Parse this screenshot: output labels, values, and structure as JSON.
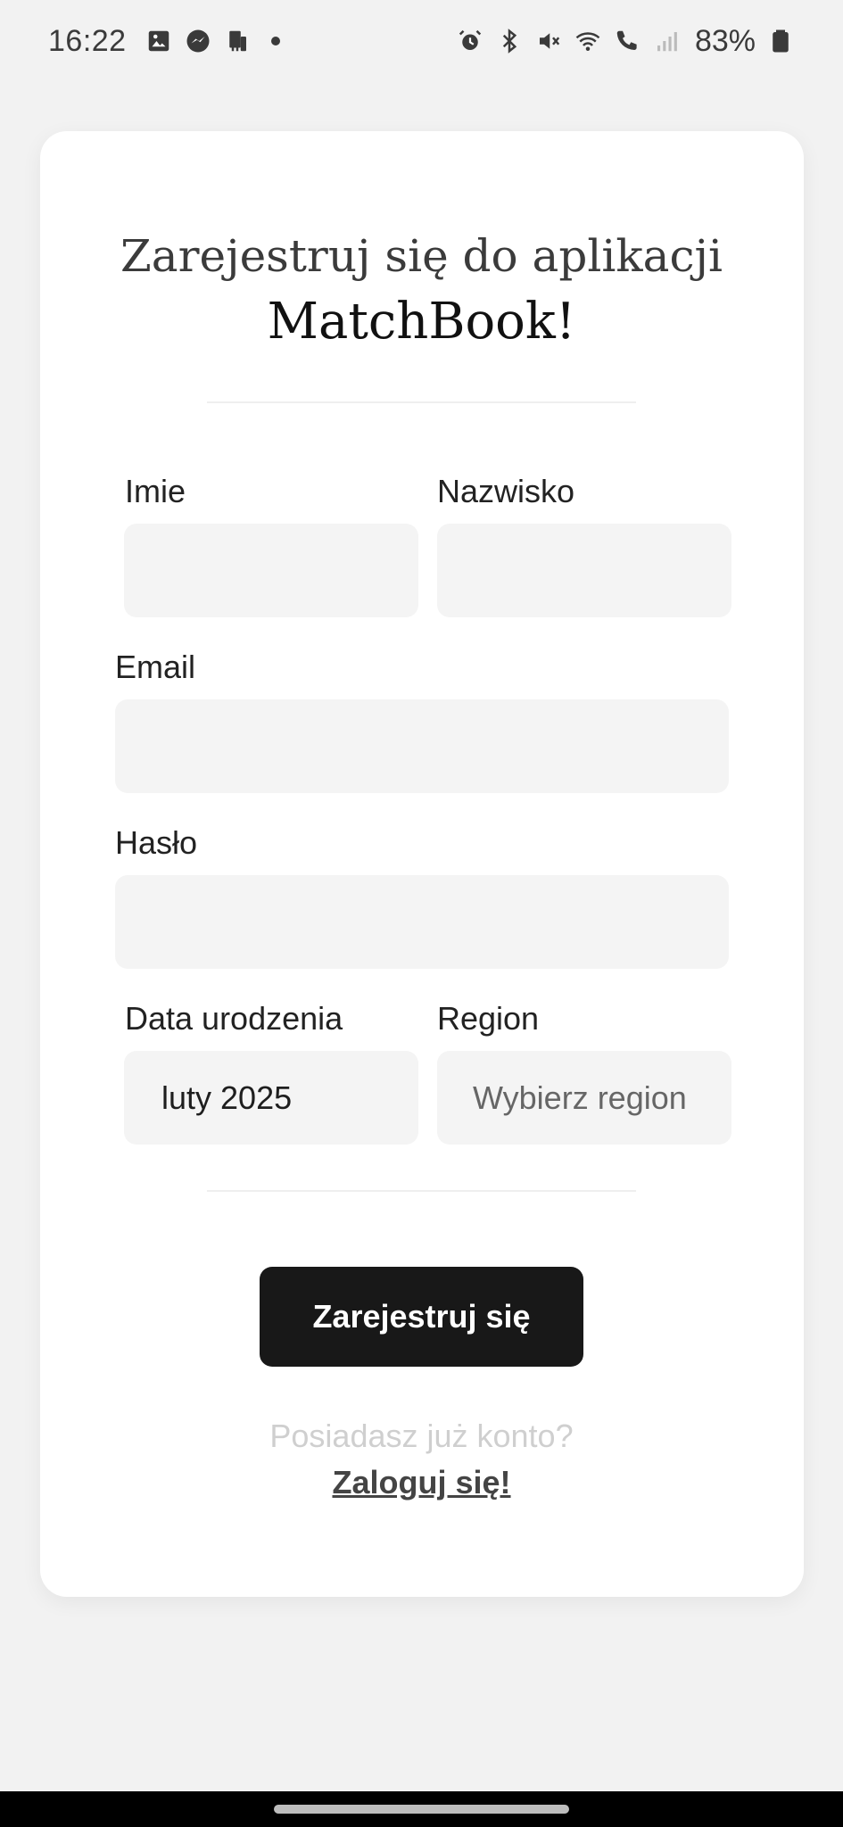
{
  "status_bar": {
    "time": "16:22",
    "left_icons": [
      "image-icon",
      "messenger-icon",
      "remote-icon",
      "dot"
    ],
    "right_icons": [
      "alarm-icon",
      "bluetooth-icon",
      "mute-icon",
      "wifi-icon",
      "wifi-call-icon",
      "signal-icon",
      "battery-icon"
    ],
    "battery": "83%"
  },
  "header": {
    "title_line1": "Zarejestruj się do aplikacji",
    "title_line2": "MatchBook!"
  },
  "form": {
    "first_name": {
      "label": "Imie",
      "value": ""
    },
    "last_name": {
      "label": "Nazwisko",
      "value": ""
    },
    "email": {
      "label": "Email",
      "value": ""
    },
    "password": {
      "label": "Hasło",
      "value": ""
    },
    "birth_date": {
      "label": "Data urodzenia",
      "value": "luty 2025"
    },
    "region": {
      "label": "Region",
      "placeholder": "Wybierz region"
    }
  },
  "actions": {
    "register_label": "Zarejestruj się",
    "have_account_text": "Posiadasz już konto?",
    "login_label": "Zaloguj się!"
  },
  "colors": {
    "background": "#f2f2f2",
    "card": "#ffffff",
    "input_bg": "#f4f4f4",
    "button_bg": "#181818",
    "button_text": "#ffffff",
    "muted_text": "#cfcfcf"
  }
}
